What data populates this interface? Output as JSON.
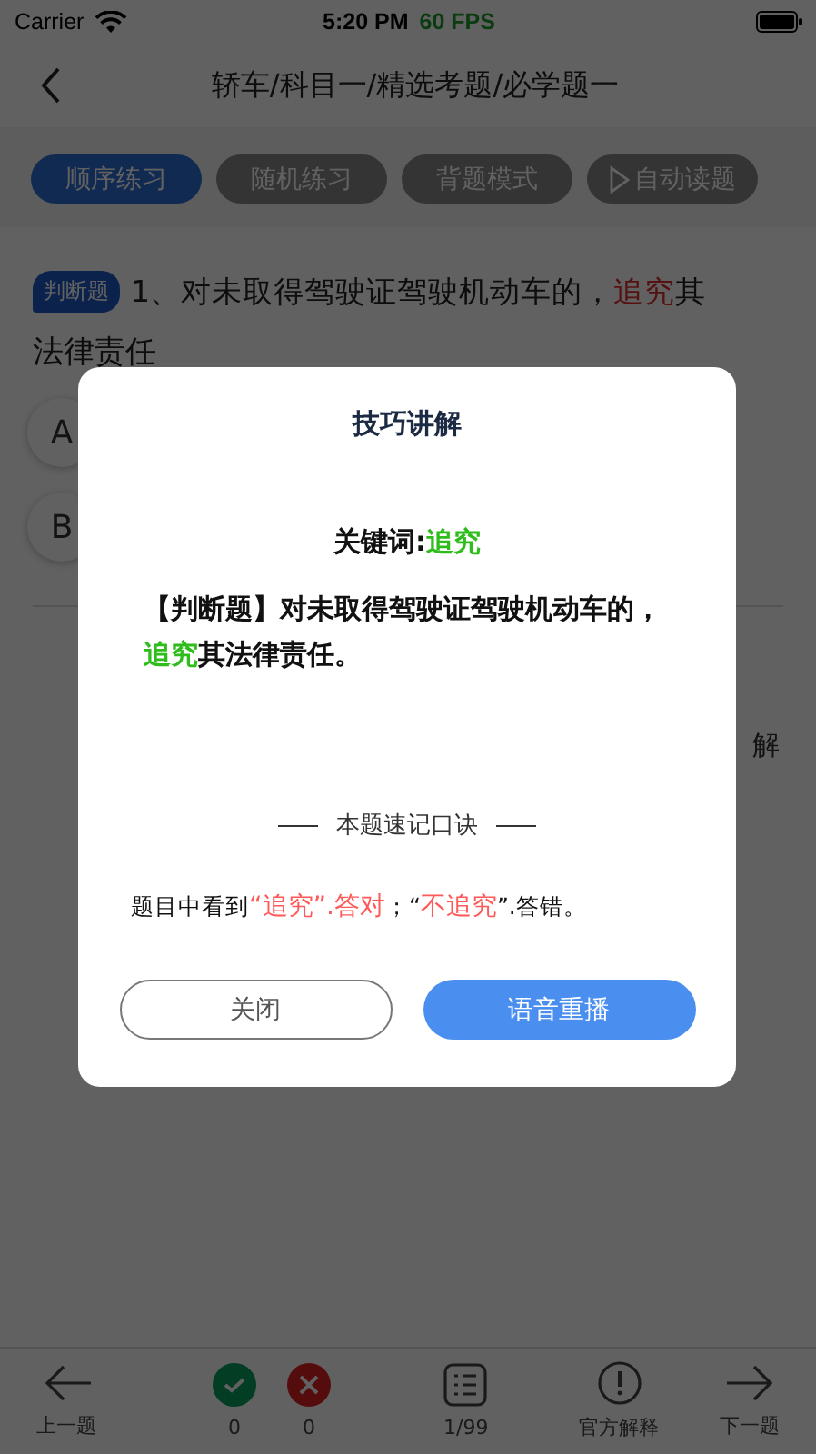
{
  "status_bar": {
    "carrier": "Carrier",
    "time": "5:20 PM",
    "fps": "60 FPS"
  },
  "nav": {
    "title": "轿车/科目一/精选考题/必学题一"
  },
  "modes": [
    {
      "label": "顺序练习",
      "selected": true,
      "kind": "text"
    },
    {
      "label": "随机练习",
      "selected": false,
      "kind": "text"
    },
    {
      "label": "背题模式",
      "selected": false,
      "kind": "text"
    },
    {
      "label": "自动读题",
      "selected": false,
      "kind": "play"
    }
  ],
  "question": {
    "tag": "判断题",
    "parts": [
      {
        "text": "1、对未取得驾驶证驾驶机动车的，",
        "highlight": false
      },
      {
        "text": "追究",
        "highlight": true
      },
      {
        "text": "其",
        "highlight": false
      }
    ],
    "line_2": "法律责任",
    "options": [
      {
        "letter": "A"
      },
      {
        "letter": "B"
      }
    ],
    "side_text": "解"
  },
  "dialog": {
    "title": "技巧讲解",
    "keyword_label": "关键词:",
    "keyword": "追究",
    "explanation": [
      {
        "text": "【判断题】对未取得驾驶证驾驶机动车的，",
        "highlight": false
      },
      {
        "text": "追究",
        "highlight": true
      },
      {
        "text": "其法律责任。",
        "highlight": false
      }
    ],
    "section_title": "本题速记口诀",
    "mnemonic": [
      {
        "text": "题目中看到",
        "highlight": false
      },
      {
        "text": "“追究”.答对",
        "highlight": true
      },
      {
        "text": "；“",
        "highlight": false
      },
      {
        "text": "不追究",
        "highlight": true
      },
      {
        "text": "”.答错。",
        "highlight": false
      }
    ],
    "buttons": [
      {
        "label": "关闭",
        "kind": "outline"
      },
      {
        "label": "语音重播",
        "kind": "primary"
      }
    ]
  },
  "bottom_bar": [
    {
      "kind": "prev",
      "label": "上一题"
    },
    {
      "kind": "right",
      "label": "0"
    },
    {
      "kind": "wrong",
      "label": "0"
    },
    {
      "kind": "list",
      "label": "1/99"
    },
    {
      "kind": "info",
      "label": "官方解释"
    },
    {
      "kind": "next",
      "label": "下一题"
    }
  ]
}
